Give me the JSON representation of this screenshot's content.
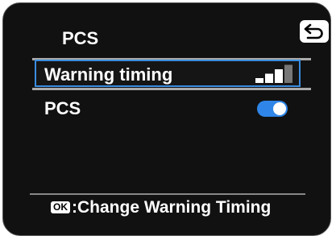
{
  "screen": {
    "title": "PCS"
  },
  "icons": {
    "back": "return-arrow-icon",
    "level": "signal-bars-icon"
  },
  "menu": {
    "items": [
      {
        "label": "Warning timing",
        "value_type": "level",
        "level": 3,
        "level_max": 4,
        "selected": true
      },
      {
        "label": "PCS",
        "value_type": "toggle",
        "on": true,
        "selected": false
      }
    ]
  },
  "footer": {
    "button_badge": "OK",
    "action_text": ":Change Warning Timing"
  },
  "colors": {
    "background": "#111111",
    "selection_border": "#3a8de0",
    "toggle_on": "#2f86e8",
    "text": "#ffffff"
  }
}
